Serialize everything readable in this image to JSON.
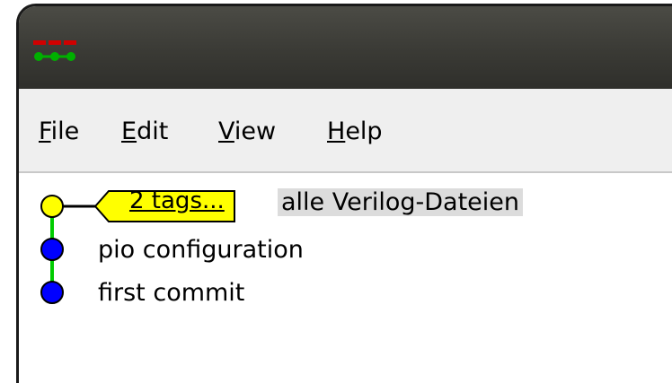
{
  "titlebar": {
    "icon": "gitk-app-icon"
  },
  "menu": [
    {
      "mnemonic": "F",
      "rest": "ile"
    },
    {
      "mnemonic": "E",
      "rest": "dit"
    },
    {
      "mnemonic": "V",
      "rest": "iew"
    },
    {
      "mnemonic": "H",
      "rest": "elp"
    }
  ],
  "commits": {
    "tag_label": "2 tags...",
    "rows": [
      {
        "message": "alle Verilog-Dateien"
      },
      {
        "message": "pio configuration"
      },
      {
        "message": "first commit"
      }
    ]
  },
  "colors": {
    "head_node": "#ffff00",
    "node": "#0000ff",
    "edge": "#00cc00",
    "tag_fill": "#ffff00",
    "selection_bg": "#dcdcdc"
  }
}
